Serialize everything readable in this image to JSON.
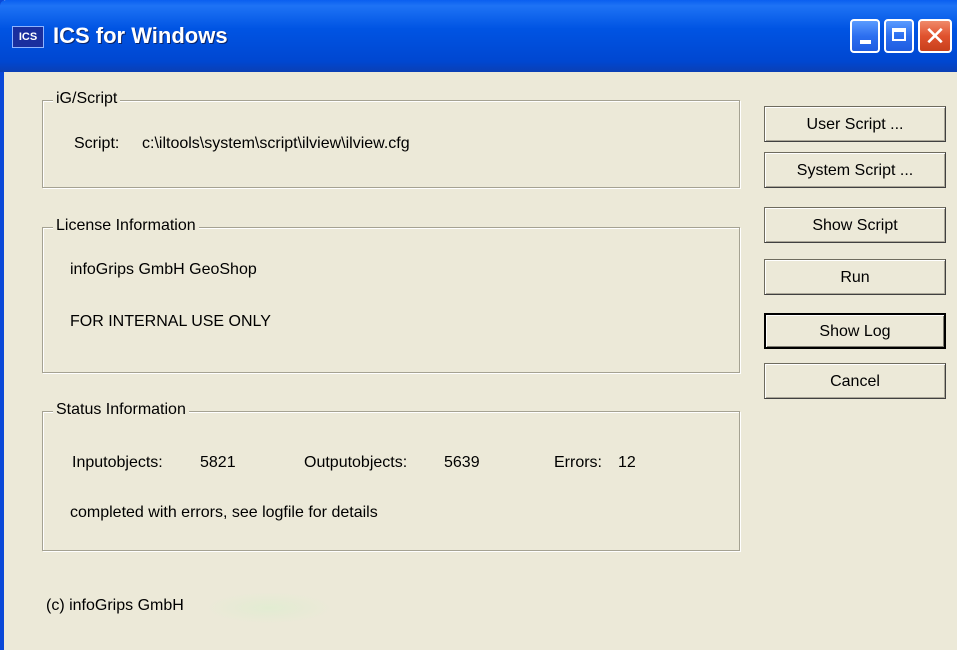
{
  "window": {
    "title": "ICS for Windows",
    "icon_label": "ICS",
    "controls": {
      "minimize_icon": "minimize-icon",
      "maximize_icon": "maximize-icon",
      "close_icon": "close-icon",
      "close_glyph": "✕"
    },
    "colors": {
      "titlebar": "#0054e3",
      "window_bg": "#ece9d8",
      "close_button": "#e0522e"
    }
  },
  "script_group": {
    "legend": "iG/Script",
    "script_label": "Script:",
    "script_path": "c:\\iltools\\system\\script\\ilview\\ilview.cfg"
  },
  "license_group": {
    "legend": "License Information",
    "licensee": "infoGrips GmbH GeoShop",
    "note": "FOR INTERNAL USE ONLY"
  },
  "status_group": {
    "legend": "Status Information",
    "input_label": "Inputobjects:",
    "input_value": "5821",
    "output_label": "Outputobjects:",
    "output_value": "5639",
    "errors_label": "Errors:",
    "errors_value": "12",
    "message": "completed with errors, see logfile for details"
  },
  "buttons": {
    "user_script": "User Script ...",
    "system_script": "System Script ...",
    "show_script": "Show Script",
    "run": "Run",
    "show_log": "Show Log",
    "cancel": "Cancel"
  },
  "footer": {
    "copyright": "(c) infoGrips GmbH"
  }
}
